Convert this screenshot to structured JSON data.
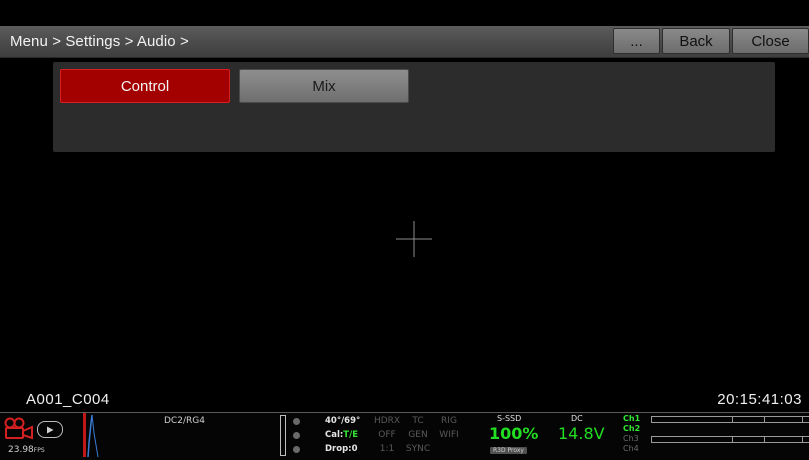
{
  "header": {
    "breadcrumb": "Menu > Settings > Audio >",
    "more_label": "...",
    "back_label": "Back",
    "close_label": "Close"
  },
  "tabs": [
    {
      "label": "Control",
      "selected": true
    },
    {
      "label": "Mix",
      "selected": false
    }
  ],
  "clip": {
    "name": "A001_C004",
    "timecode": "20:15:41:03"
  },
  "status": {
    "fps": "23.98",
    "fps_unit": "FPS",
    "codec": "DC2/RG4",
    "sensor": {
      "temp": "40°/69°",
      "cal_prefix": "Cal:",
      "cal_value": "T/E",
      "drop": "Drop:0"
    },
    "grid": [
      [
        "HDRX",
        "TC",
        "RIG"
      ],
      [
        "OFF",
        "GEN",
        "WIFI"
      ],
      [
        "1:1",
        "SYNC",
        ""
      ]
    ],
    "media": {
      "label": "S-SSD",
      "percent": "100%",
      "badge": "R3D Proxy"
    },
    "power": {
      "label": "DC",
      "voltage": "14.8V"
    },
    "channels": [
      "Ch1",
      "Ch2",
      "Ch3",
      "Ch4"
    ]
  },
  "colors": {
    "accent_red": "#a30000",
    "status_green": "#22dd22"
  },
  "icons": {
    "record": "record-camera-icon",
    "playback": "play-icon",
    "crosshair": "crosshair-icon"
  }
}
